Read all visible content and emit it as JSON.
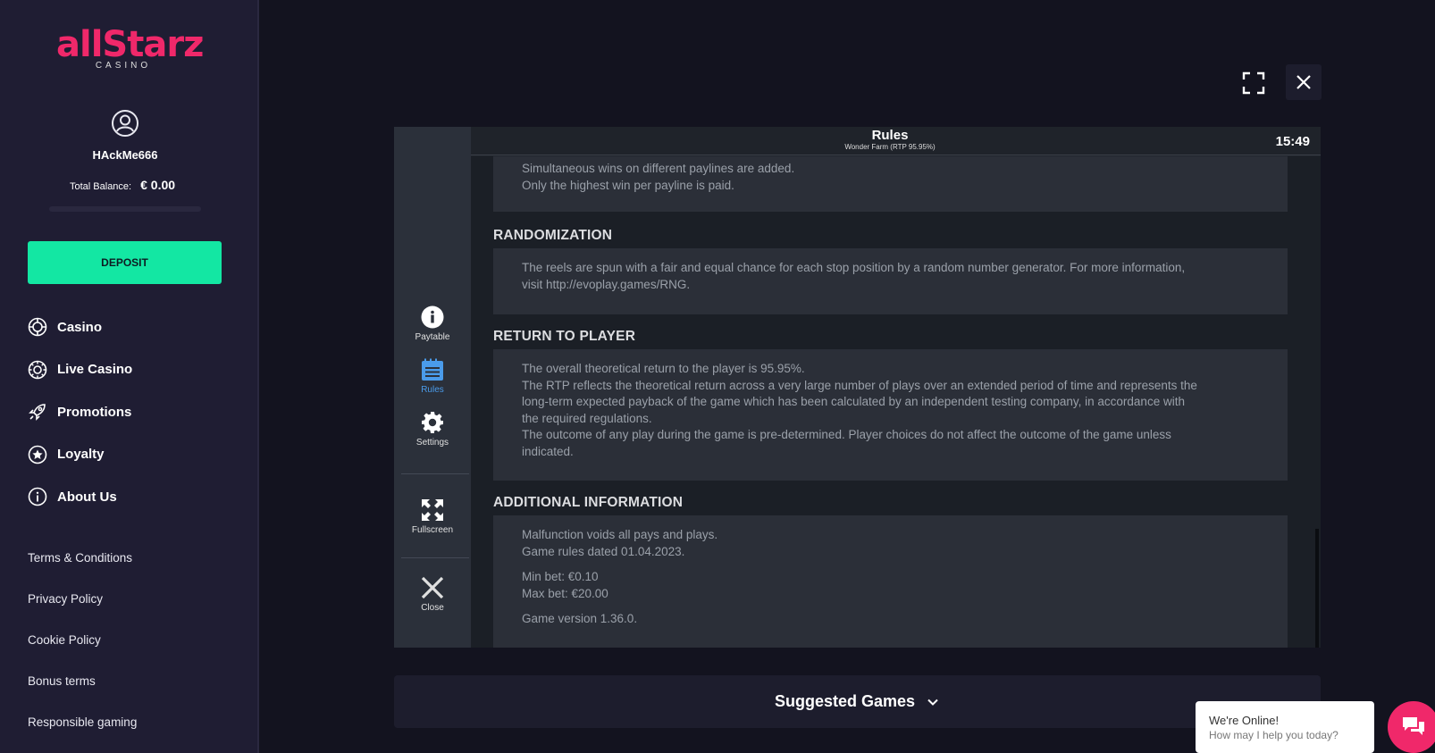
{
  "sidebar": {
    "logo_text": "allStarz",
    "logo_sub": "CASINO",
    "username": "HAckMe666",
    "balance_label": "Total Balance:",
    "balance_value": "€ 0.00",
    "deposit_label": "DEPOSIT",
    "nav": [
      {
        "label": "Casino",
        "icon": "casino-chip-icon"
      },
      {
        "label": "Live Casino",
        "icon": "live-casino-icon"
      },
      {
        "label": "Promotions",
        "icon": "rocket-icon"
      },
      {
        "label": "Loyalty",
        "icon": "star-icon"
      },
      {
        "label": "About Us",
        "icon": "info-icon"
      }
    ],
    "links": [
      "Terms & Conditions",
      "Privacy Policy",
      "Cookie Policy",
      "Bonus terms",
      "Responsible gaming"
    ]
  },
  "game": {
    "header_title": "Rules",
    "header_subtitle": "Wonder Farm (RTP 95.95%)",
    "time": "15:49",
    "side_buttons": {
      "paytable": "Paytable",
      "rules": "Rules",
      "settings": "Settings",
      "fullscreen": "Fullscreen",
      "close": "Close"
    },
    "rules": {
      "paylines_lines": [
        "Simultaneous wins on different paylines are added.",
        "Only the highest win per payline is paid."
      ],
      "randomization_title": "RANDOMIZATION",
      "randomization_lines": [
        "The reels are spun with a fair and equal chance for each stop position by a random number generator. For more information,",
        "visit http://evoplay.games/RNG."
      ],
      "rtp_title": "RETURN TO PLAYER",
      "rtp_lines": [
        "The overall theoretical return to the player is 95.95%.",
        "The RTP reflects the theoretical return across a very large number of plays over an extended period of time and represents the",
        "long-term expected payback of the game which has been calculated by an independent testing company, in accordance with",
        "the required regulations.",
        "The outcome of any play during the game is pre-determined. Player choices do not affect the outcome of the game unless",
        "indicated."
      ],
      "additional_title": "ADDITIONAL INFORMATION",
      "additional_lines": [
        "Malfunction voids all pays and plays.",
        "Game rules dated 01.04.2023."
      ],
      "bet_lines": [
        "Min bet: €0.10",
        "Max bet: €20.00"
      ],
      "version_line": "Game version 1.36.0."
    }
  },
  "suggested_label": "Suggested Games",
  "chat": {
    "title": "We're Online!",
    "subtitle": "How may I help you today?"
  },
  "colors": {
    "brand": "#f0286a",
    "deposit": "#13e7a3",
    "active_tab": "#4a9bea"
  }
}
